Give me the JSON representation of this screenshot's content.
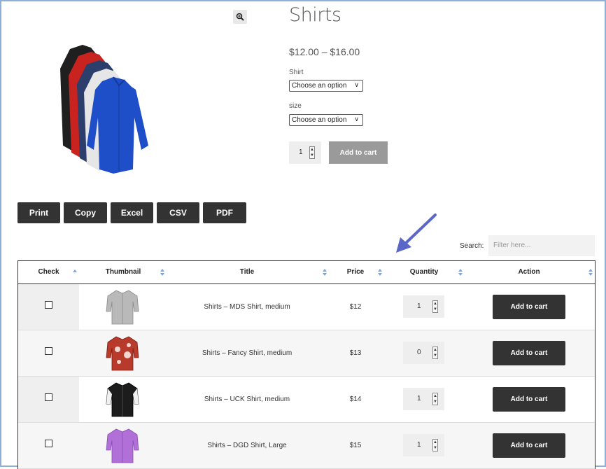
{
  "product": {
    "title": "Shirts",
    "price_range": "$12.00 – $16.00",
    "image_icon": "stacked-shirts-image",
    "zoom_icon": "zoom-in-icon",
    "variations": [
      {
        "label": "Shirt",
        "selected": "Choose an option"
      },
      {
        "label": "size",
        "selected": "Choose an option"
      }
    ],
    "quantity": "1",
    "add_to_cart": "Add to cart"
  },
  "export_buttons": [
    "Print",
    "Copy",
    "Excel",
    "CSV",
    "PDF"
  ],
  "search": {
    "label": "Search:",
    "placeholder": "Filter here..."
  },
  "table": {
    "columns": [
      "Check",
      "Thumbnail",
      "Title",
      "Price",
      "Quantity",
      "Action"
    ],
    "rows": [
      {
        "title": "Shirts – MDS Shirt, medium",
        "price": "$12",
        "quantity": "1",
        "action": "Add to cart",
        "thumb_color": "#b9b9b9",
        "thumb_icon": "grey-shirt-thumbnail"
      },
      {
        "title": "Shirts – Fancy Shirt, medium",
        "price": "$13",
        "quantity": "0",
        "action": "Add to cart",
        "thumb_color": "#b83a2a",
        "thumb_icon": "floral-shirt-thumbnail"
      },
      {
        "title": "Shirts – UCK Shirt, medium",
        "price": "$14",
        "quantity": "1",
        "action": "Add to cart",
        "thumb_color": "#1c1c1c",
        "thumb_icon": "black-white-shirt-thumbnail"
      },
      {
        "title": "Shirts – DGD Shirt, Large",
        "price": "$15",
        "quantity": "1",
        "action": "Add to cart",
        "thumb_color": "#b070d8",
        "thumb_icon": "purple-shirt-thumbnail"
      }
    ]
  },
  "colors": {
    "dark_button": "#333333",
    "disabled_button": "#9a9a9a",
    "sort_arrow": "#7fa7d8",
    "annotation_arrow": "#5a67c8"
  }
}
